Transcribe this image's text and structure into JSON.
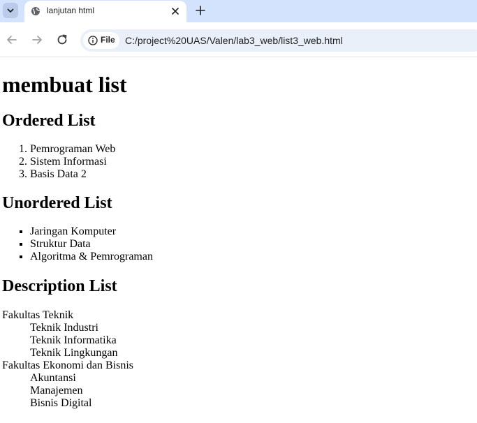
{
  "browser": {
    "tab_title": "lanjutan html",
    "site_chip_label": "File",
    "url": "C:/project%20UAS/Valen/lab3_web/list3_web.html"
  },
  "page": {
    "heading": "membuat list",
    "ordered": {
      "title": "Ordered List",
      "items": [
        "Pemrograman Web",
        "Sistem Informasi",
        "Basis Data 2"
      ]
    },
    "unordered": {
      "title": "Unordered List",
      "items": [
        "Jaringan Komputer",
        "Struktur Data",
        "Algoritma & Pemrograman"
      ]
    },
    "description": {
      "title": "Description List",
      "groups": [
        {
          "term": "Fakultas Teknik",
          "defs": [
            "Teknik Industri",
            "Teknik Informatika",
            "Teknik Lingkungan"
          ]
        },
        {
          "term": "Fakultas Ekonomi dan Bisnis",
          "defs": [
            "Akuntansi",
            "Manajemen",
            "Bisnis Digital"
          ]
        }
      ]
    }
  }
}
